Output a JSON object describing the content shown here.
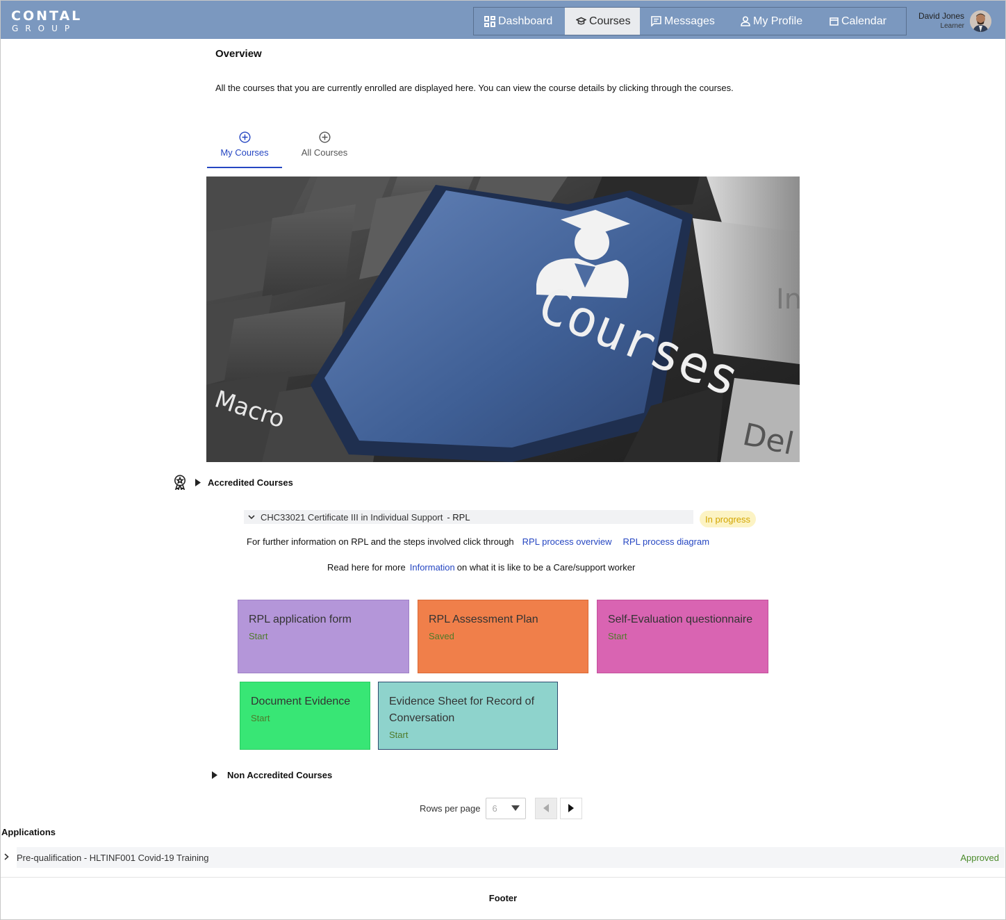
{
  "brand": {
    "line1": "CONTAL",
    "line2": "GROUP"
  },
  "nav": {
    "items": [
      {
        "label": "Dashboard",
        "icon": "dashboard-icon"
      },
      {
        "label": "Courses",
        "icon": "graduation-cap-icon",
        "active": true
      },
      {
        "label": "Messages",
        "icon": "message-icon"
      },
      {
        "label": "My Profile",
        "icon": "person-icon"
      },
      {
        "label": "Calendar",
        "icon": "calendar-icon"
      }
    ]
  },
  "user": {
    "name": "David Jones",
    "role": "Learner"
  },
  "page": {
    "title": "Overview",
    "description": "All the courses that you are currently enrolled are displayed here. You can view the course details by clicking through the courses."
  },
  "tabs": [
    {
      "label": "My Courses",
      "active": true
    },
    {
      "label": "All Courses",
      "active": false
    }
  ],
  "hero": {
    "key_text": "Courses",
    "left_key": "Macro",
    "right_key": "Del",
    "side_key": "In"
  },
  "accredited": {
    "label": "Accredited Courses",
    "course": {
      "code": "CHC33021 Certificate III in Individual Support",
      "suffix": " - RPL",
      "status": "In progress"
    },
    "rpl_text": "For further information on RPL and the steps involved click through",
    "rpl_links": [
      "RPL process overview",
      "RPL process diagram"
    ],
    "info_prefix": "Read here for more",
    "info_link": "Information",
    "info_suffix": "on what it is like to be a Care/support worker",
    "cards": [
      {
        "title": "RPL application form",
        "status": "Start",
        "color": "#b496d9"
      },
      {
        "title": "RPL Assessment Plan",
        "status": "Saved",
        "color": "#f07f4a"
      },
      {
        "title": "Self-Evaluation questionnaire",
        "status": "Start",
        "color": "#d964b2"
      },
      {
        "title": "Document Evidence",
        "status": "Start",
        "color": "#38e675"
      },
      {
        "title": "Evidence Sheet for Record of Conversation",
        "status": "Start",
        "color": "#8ed3cc"
      }
    ]
  },
  "non_accredited": {
    "label": "Non Accredited Courses"
  },
  "pagination": {
    "rows_label": "Rows per page",
    "rows_value": "6"
  },
  "applications": {
    "title": "Applications",
    "items": [
      {
        "label": "Pre-qualification - HLTINF001 Covid-19 Training",
        "status": "Approved"
      }
    ]
  },
  "footer": {
    "label": "Footer"
  },
  "colors": {
    "header": "#7b98bf",
    "accent": "#2546c2",
    "approved": "#4a8a2a",
    "in_progress": "#d2a500"
  }
}
